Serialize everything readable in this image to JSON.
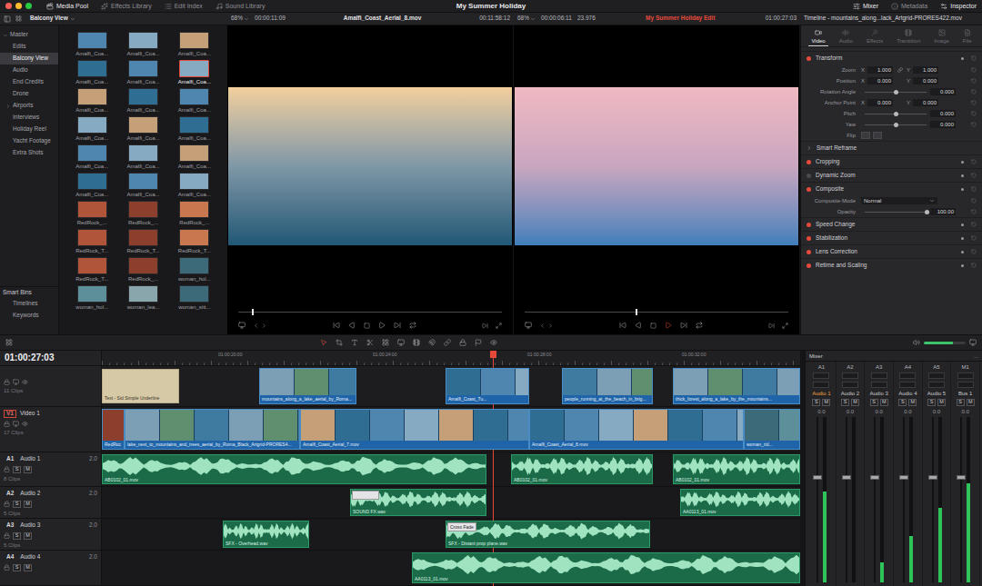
{
  "window": {
    "title": "My Summer Holiday"
  },
  "top_bar": {
    "left_tabs": [
      {
        "label": "Media Pool",
        "selected": true
      },
      {
        "label": "Effects Library",
        "selected": false
      },
      {
        "label": "Edit Index",
        "selected": false
      },
      {
        "label": "Sound Library",
        "selected": false
      }
    ],
    "right_tabs": [
      {
        "label": "Mixer",
        "selected": true
      },
      {
        "label": "Metadata",
        "selected": false
      },
      {
        "label": "Inspector",
        "selected": true
      }
    ]
  },
  "source_viewer": {
    "zoom": "68%",
    "timecode": "00:00:11:09",
    "clip": "Amalfi_Coast_Aerial_8.mov",
    "duration": "00:11:58:12",
    "playhead": 0.05
  },
  "timeline_viewer": {
    "zoom": "68%",
    "timecode": "00:00:06:11",
    "fps": "23.976",
    "timeline": "My Summer Holiday Edit",
    "current": "01:00:27:03",
    "playhead": 0.42
  },
  "media_pool": {
    "current_bin": "Balcony View",
    "bins": [
      {
        "label": "Master",
        "kind": "root",
        "selected": false,
        "expanded": true
      },
      {
        "label": "Edits",
        "kind": "bin",
        "selected": false,
        "expanded": false
      },
      {
        "label": "Balcony View",
        "kind": "bin",
        "selected": true,
        "expanded": false
      },
      {
        "label": "Audio",
        "kind": "bin",
        "selected": false,
        "expanded": false
      },
      {
        "label": "End Credits",
        "kind": "bin",
        "selected": false,
        "expanded": false
      },
      {
        "label": "Drone",
        "kind": "bin",
        "selected": false,
        "expanded": false
      },
      {
        "label": "Airports",
        "kind": "folder",
        "selected": false,
        "expanded": false
      },
      {
        "label": "Interviews",
        "kind": "bin",
        "selected": false,
        "expanded": false
      },
      {
        "label": "Holiday Reel",
        "kind": "bin",
        "selected": false,
        "expanded": false
      },
      {
        "label": "Yacht Footage",
        "kind": "bin",
        "selected": false,
        "expanded": false
      },
      {
        "label": "Extra Shots",
        "kind": "bin",
        "selected": false,
        "expanded": false
      }
    ],
    "smart_bins": {
      "title": "Smart Bins",
      "items": [
        {
          "label": "Timelines",
          "selected": false
        },
        {
          "label": "Keywords",
          "selected": false
        }
      ]
    },
    "clips": [
      {
        "label": "Amalfi_Coa...",
        "selected": false
      },
      {
        "label": "Amalfi_Coa...",
        "selected": false
      },
      {
        "label": "Amalfi_Coa...",
        "selected": false
      },
      {
        "label": "Amalfi_Coa...",
        "selected": false
      },
      {
        "label": "Amalfi_Coa...",
        "selected": false
      },
      {
        "label": "Amalfi_Coa...",
        "selected": true
      },
      {
        "label": "Amalfi_Coa...",
        "selected": false
      },
      {
        "label": "Amalfi_Coa...",
        "selected": false
      },
      {
        "label": "Amalfi_Coa...",
        "selected": false
      },
      {
        "label": "Amalfi_Coa...",
        "selected": false
      },
      {
        "label": "Amalfi_Coa...",
        "selected": false
      },
      {
        "label": "Amalfi_Coa...",
        "selected": false
      },
      {
        "label": "Amalfi_Coa...",
        "selected": false
      },
      {
        "label": "Amalfi_Coa...",
        "selected": false
      },
      {
        "label": "Amalfi_Coa...",
        "selected": false
      },
      {
        "label": "Amalfi_Coa...",
        "selected": false
      },
      {
        "label": "Amalfi_Coa...",
        "selected": false
      },
      {
        "label": "Amalfi_Coa...",
        "selected": false
      },
      {
        "label": "RedRock_...",
        "selected": false
      },
      {
        "label": "RedRock_...",
        "selected": false
      },
      {
        "label": "RedRock_...",
        "selected": false
      },
      {
        "label": "RedRock_T...",
        "selected": false
      },
      {
        "label": "RedRock_T...",
        "selected": false
      },
      {
        "label": "RedRock_T...",
        "selected": false
      },
      {
        "label": "RedRock_T...",
        "selected": false
      },
      {
        "label": "RedRock_...",
        "selected": false
      },
      {
        "label": "woman_hol...",
        "selected": false
      },
      {
        "label": "woman_hol...",
        "selected": false
      },
      {
        "label": "woman_lea...",
        "selected": false
      },
      {
        "label": "woman_sitt...",
        "selected": false
      }
    ]
  },
  "inspector": {
    "title": "Timeline - mountains_along...lack_Artgrid-PRORES422.mov",
    "tabs": [
      {
        "label": "Video",
        "selected": true
      },
      {
        "label": "Audio",
        "selected": false
      },
      {
        "label": "Effects",
        "selected": false
      },
      {
        "label": "Transition",
        "selected": false
      },
      {
        "label": "Image",
        "selected": false
      },
      {
        "label": "File",
        "selected": false
      }
    ],
    "axis_labels": [
      "X",
      "Y"
    ],
    "sections": [
      {
        "title": "Transform",
        "kind": "toggle",
        "enabled": true,
        "expanded": true,
        "params": [
          {
            "label": "Zoom",
            "kind": "xy",
            "x": "1.000",
            "y": "1.000",
            "linked": true
          },
          {
            "label": "Position",
            "kind": "xy",
            "x": "0.000",
            "y": "0.000",
            "linked": false
          },
          {
            "label": "Rotation Angle",
            "kind": "slider",
            "value": "0.000",
            "level": 0.5
          },
          {
            "label": "Anchor Point",
            "kind": "xy",
            "x": "0.000",
            "y": "0.000",
            "linked": false
          },
          {
            "label": "Pitch",
            "kind": "slider",
            "value": "0.000",
            "level": 0.5
          },
          {
            "label": "Yaw",
            "kind": "slider",
            "value": "0.000",
            "level": 0.5
          },
          {
            "label": "Flip",
            "kind": "flip"
          }
        ]
      },
      {
        "title": "Smart Reframe",
        "kind": "group",
        "enabled": false,
        "expanded": false,
        "params": []
      },
      {
        "title": "Cropping",
        "kind": "toggle",
        "enabled": true,
        "expanded": false,
        "params": []
      },
      {
        "title": "Dynamic Zoom",
        "kind": "toggle",
        "enabled": false,
        "expanded": false,
        "params": []
      },
      {
        "title": "Composite",
        "kind": "toggle",
        "enabled": true,
        "expanded": true,
        "params": [
          {
            "label": "Composite Mode",
            "kind": "dropdown",
            "value": "Normal"
          },
          {
            "label": "Opacity",
            "kind": "slider",
            "value": "100.00",
            "level": 1
          }
        ]
      },
      {
        "title": "Speed Change",
        "kind": "toggle",
        "enabled": true,
        "expanded": false,
        "params": []
      },
      {
        "title": "Stabilization",
        "kind": "toggle",
        "enabled": true,
        "expanded": false,
        "params": []
      },
      {
        "title": "Lens Correction",
        "kind": "toggle",
        "enabled": true,
        "expanded": false,
        "params": []
      },
      {
        "title": "Retime and Scaling",
        "kind": "toggle",
        "enabled": true,
        "expanded": false,
        "params": []
      }
    ]
  },
  "toolbar": {
    "volume": 0.7
  },
  "timeline": {
    "timecode": "01:00:27:03",
    "ticks": [
      "01:00:20:00",
      "01:00:24:00",
      "01:00:28:00",
      "01:00:32:00"
    ],
    "playhead": 0.56,
    "audio_buttons": [
      "S",
      "M"
    ],
    "tracks": [
      {
        "kind": "video",
        "clips_count": "11 Clips",
        "selected": false,
        "clips": [
          {
            "label": "Text - Sid Simple Underline",
            "kind": "title"
          },
          {
            "label": "mountains_along_a_lake_aerial_by_Roma...",
            "kind": "video"
          },
          {
            "label": "Amalfi_Coast_Tu...",
            "kind": "video"
          },
          {
            "label": "people_running_at_the_beach_in_brig...",
            "kind": "video"
          },
          {
            "label": "thick_forest_along_a_lake_by_the_mountains...",
            "kind": "video"
          }
        ]
      },
      {
        "kind": "video",
        "code": "V1",
        "name": "Video 1",
        "clips_count": "17 Clips",
        "selected": true,
        "clips": [
          {
            "label": "RedRoc",
            "kind": "video"
          },
          {
            "label": "lake_next_to_mountains_and_trees_aerial_by_Roma_Black_Artgrid-PRORES4...",
            "kind": "video"
          },
          {
            "label": "Amalfi_Coast_Aerial_7.mov",
            "kind": "video"
          },
          {
            "label": "Amalfi_Coast_Aerial_8.mov",
            "kind": "video"
          },
          {
            "label": "woman_rid...",
            "kind": "video"
          }
        ]
      },
      {
        "kind": "audio",
        "code": "A1",
        "name": "Audio 1",
        "format": "2.0",
        "clips_count": "8 Clips",
        "selected": false,
        "clips": [
          {
            "label": "AB0102_01.mov",
            "kind": "audio",
            "transition": false
          },
          {
            "label": "AB0102_01.mov",
            "kind": "audio",
            "transition": false
          },
          {
            "label": "AB0102_01.mov",
            "kind": "audio",
            "transition": false
          }
        ]
      },
      {
        "kind": "audio",
        "code": "A2",
        "name": "Audio 2",
        "format": "2.0",
        "clips_count": "5 Clips",
        "selected": false,
        "clips": [
          {
            "label": "SOUND FX.wav",
            "kind": "audio",
            "transition": true
          },
          {
            "label": "AA0113_01.mov",
            "kind": "audio",
            "transition": false
          }
        ]
      },
      {
        "kind": "audio",
        "code": "A3",
        "name": "Audio 3",
        "format": "2.0",
        "clips_count": "5 Clips",
        "selected": false,
        "clips": [
          {
            "label": "SFX - Overhead.wav",
            "kind": "audio",
            "transition": false
          },
          {
            "label": "SFX - Distant prop plane.wav",
            "kind": "audio",
            "transition": true,
            "transition_label": "Cross Fade"
          }
        ]
      },
      {
        "kind": "audio",
        "code": "A4",
        "name": "Audio 4",
        "format": "2.0",
        "selected": false,
        "clips": [
          {
            "label": "AA0113_01.mov",
            "kind": "audio",
            "transition": false
          }
        ]
      }
    ]
  },
  "mixer": {
    "title": "Mixer",
    "menu": "...",
    "channels": [
      {
        "code": "A1",
        "name": "Audio 1",
        "selected": true,
        "fader": "0.0",
        "fader_level": 0.62,
        "level": 0.55
      },
      {
        "code": "A2",
        "name": "Audio 2",
        "selected": false,
        "fader": "0.0",
        "fader_level": 0.62,
        "level": 0.0
      },
      {
        "code": "A3",
        "name": "Audio 3",
        "selected": false,
        "fader": "0.0",
        "fader_level": 0.62,
        "level": 0.12
      },
      {
        "code": "A4",
        "name": "Audio 4",
        "selected": false,
        "fader": "0.0",
        "fader_level": 0.62,
        "level": 0.28
      },
      {
        "code": "A5",
        "name": "Audio 5",
        "selected": false,
        "fader": "0.0",
        "fader_level": 0.62,
        "level": 0.45
      },
      {
        "code": "M1",
        "name": "Bus 1",
        "selected": false,
        "fader": "0.0",
        "fader_level": 0.62,
        "level": 0.6
      }
    ]
  }
}
